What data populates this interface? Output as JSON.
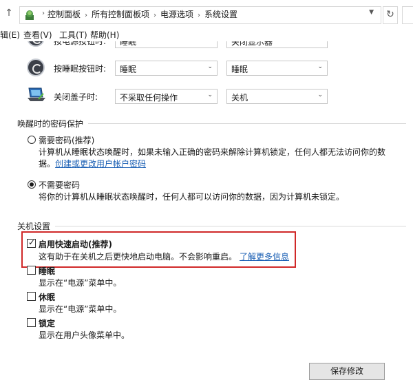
{
  "address_bar": {
    "crumbs": [
      "控制面板",
      "所有控制面板项",
      "电源选项",
      "系统设置"
    ]
  },
  "menu": [
    "辑(E)",
    "查看(V)",
    "工具(T)",
    "帮助(H)"
  ],
  "power_buttons": {
    "rows": [
      {
        "label": "按电源按钮时:",
        "battery": "睡眠",
        "plugged": "关闭显示器"
      },
      {
        "label": "按睡眠按钮时:",
        "battery": "睡眠",
        "plugged": "睡眠"
      },
      {
        "label": "关闭盖子时:",
        "battery": "不采取任何操作",
        "plugged": "关机"
      }
    ]
  },
  "password": {
    "heading": "唤醒时的密码保护",
    "options": [
      {
        "label": "需要密码(推荐)",
        "desc_1": "计算机从睡眠状态唤醒时，如果未输入正确的密码来解除计算机锁定，任何人都无法访问你的数",
        "desc_2": "据。",
        "link": "创建或更改用户帐户密码",
        "selected": false
      },
      {
        "label": "不需要密码",
        "desc_1": "将你的计算机从睡眠状态唤醒时，任何人都可以访问你的数据，因为计算机未锁定。",
        "selected": true
      }
    ]
  },
  "shutdown": {
    "heading": "关机设置",
    "items": [
      {
        "label": "启用快速启动(推荐)",
        "desc": "这有助于在关机之后更快地启动电脑。不会影响重启。",
        "link": "了解更多信息",
        "checked": true
      },
      {
        "label": "睡眠",
        "desc": "显示在“电源”菜单中。",
        "checked": false
      },
      {
        "label": "休眠",
        "desc": "显示在“电源”菜单中。",
        "checked": false
      },
      {
        "label": "锁定",
        "desc": "显示在用户头像菜单中。",
        "checked": false
      }
    ]
  },
  "save_button": "保存修改",
  "colors": {
    "highlight": "#d02828",
    "link": "#1a5fb4"
  },
  "icons": [
    "up-arrow-icon",
    "control-panel-icon",
    "refresh-icon",
    "power-button-icon",
    "sleep-button-icon",
    "laptop-lid-icon"
  ]
}
